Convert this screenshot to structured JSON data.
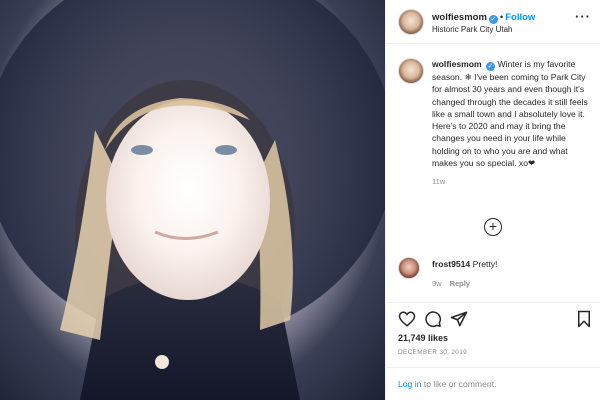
{
  "post": {
    "author": "wolfiesmom",
    "location": "Historic Park City Utah",
    "follow_label": "Follow",
    "separator": "•",
    "more_icon": "more-horizontal-icon",
    "caption": {
      "username": "wolfiesmom",
      "text": "Winter is my favorite season. ❄ I've been coming to Park City for almost 30 years and even though it's changed through the decades it still feels like a small town and I absolutely love it. Here's to 2020 and may it bring the changes you need in your life while holding on to who you are and what makes you so special. xo❤",
      "time": "11w"
    },
    "load_more_icon": "plus-circle-icon",
    "comments": [
      {
        "username": "frost9514",
        "text": "Pretty!",
        "time": "9w",
        "reply_label": "Reply"
      }
    ],
    "likes": "21,749 likes",
    "date": "DECEMBER 30, 2019",
    "login": {
      "link": "Log in",
      "rest": " to like or comment."
    }
  },
  "colors": {
    "accent": "#0095f6",
    "verified": "#3897f0",
    "muted": "#8e8e8e",
    "text": "#262626"
  }
}
